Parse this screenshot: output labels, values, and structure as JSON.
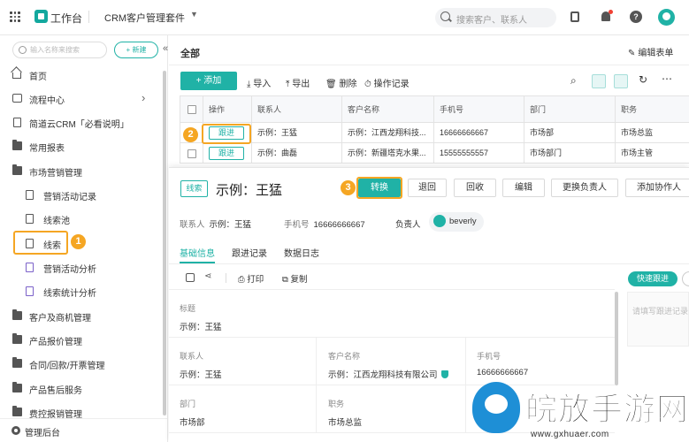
{
  "topbar": {
    "workspace": "工作台",
    "app_title": "CRM客户管理套件",
    "search_placeholder": "搜索客户、联系人"
  },
  "sidebar": {
    "search_placeholder": "输入名称来搜索",
    "new_label": "+ 新建",
    "items": [
      {
        "label": "首页"
      },
      {
        "label": "流程中心"
      },
      {
        "label": "简道云CRM「必看说明」"
      },
      {
        "label": "常用报表"
      },
      {
        "label": "市场营销管理"
      },
      {
        "label": "营销活动记录"
      },
      {
        "label": "线索池"
      },
      {
        "label": "线索"
      },
      {
        "label": "营销活动分析"
      },
      {
        "label": "线索统计分析"
      },
      {
        "label": "客户及商机管理"
      },
      {
        "label": "产品报价管理"
      },
      {
        "label": "合同/回款/开票管理"
      },
      {
        "label": "产品售后服务"
      },
      {
        "label": "费控报销管理"
      }
    ],
    "admin_label": "管理后台"
  },
  "markers": {
    "m1": "1",
    "m2": "2",
    "m3": "3"
  },
  "main": {
    "title": "全部",
    "edit_form": "编辑表单",
    "toolbar": {
      "add": "+ 添加",
      "import": "导入",
      "export": "导出",
      "delete": "删除",
      "log": "操作记录"
    },
    "table": {
      "headers": [
        "操作",
        "联系人",
        "客户名称",
        "手机号",
        "部门",
        "职务"
      ],
      "follow_label": "跟进",
      "rows": [
        [
          "示例：王猛",
          "示例：江西龙翔科技...",
          "16666666667",
          "市场部",
          "市场总监"
        ],
        [
          "示例：曲磊",
          "示例：新疆塔克水果...",
          "15555555557",
          "市场部门",
          "市场主管"
        ]
      ]
    }
  },
  "detail": {
    "tag": "线索",
    "title": "示例：王猛",
    "buttons": {
      "convert": "转换",
      "back": "退回",
      "recycle": "回收",
      "edit": "编辑",
      "change_owner": "更换负责人",
      "add_collab": "添加协作人"
    },
    "meta": {
      "contact_key": "联系人",
      "contact_val": "示例：王猛",
      "phone_key": "手机号",
      "phone_val": "16666666667",
      "owner_key": "负责人",
      "owner_val": "beverly"
    },
    "tabs": [
      "基础信息",
      "跟进记录",
      "数据日志"
    ],
    "actions": {
      "print": "打印",
      "copy": "复制"
    },
    "quick_follow": "快速跟进",
    "quick_placeholder": "请填写跟进记录",
    "fields": {
      "title": {
        "k": "标题",
        "v": "示例：王猛"
      },
      "contact": {
        "k": "联系人",
        "v": "示例：王猛"
      },
      "customer": {
        "k": "客户名称",
        "v": "示例：江西龙翔科技有限公司"
      },
      "phone": {
        "k": "手机号",
        "v": "16666666667"
      },
      "dept": {
        "k": "部门",
        "v": "市场部"
      },
      "position": {
        "k": "职务",
        "v": "市场总监"
      }
    }
  },
  "watermark": {
    "text": "皖放手游网",
    "url": "www.gxhuaer.com"
  }
}
